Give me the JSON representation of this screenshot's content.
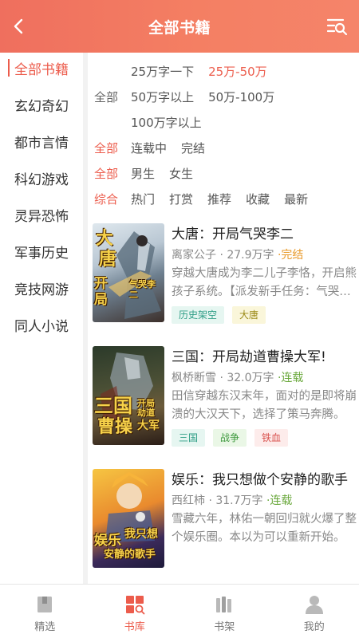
{
  "header": {
    "title": "全部书籍"
  },
  "sidebar": {
    "items": [
      {
        "label": "全部书籍",
        "active": true
      },
      {
        "label": "玄幻奇幻"
      },
      {
        "label": "都市言情"
      },
      {
        "label": "科幻游戏"
      },
      {
        "label": "灵异恐怖"
      },
      {
        "label": "军事历史"
      },
      {
        "label": "竞技网游"
      },
      {
        "label": "同人小说"
      }
    ]
  },
  "filters": {
    "words": {
      "lead": "全部",
      "options": [
        "25万字一下",
        "25万-50万",
        "50万字以上",
        "50万-100万",
        "100万字以上"
      ],
      "selected": "25万-50万"
    },
    "status": {
      "lead": "全部",
      "options": [
        "连载中",
        "完结"
      ]
    },
    "gender": {
      "lead": "全部",
      "options": [
        "男生",
        "女生"
      ]
    },
    "sort": {
      "lead": "综合",
      "options": [
        "热门",
        "打赏",
        "推荐",
        "收藏",
        "最新"
      ]
    }
  },
  "books": [
    {
      "title": "大唐：开局气哭李二",
      "author": "离家公子",
      "words": "27.9万字",
      "status": "·完结",
      "desc": "穿越大唐成为李二儿子李恪，开启熊孩子系统。【派发新手任务：气哭李二。】",
      "tags": [
        "历史架空",
        "大唐"
      ],
      "cover_text": [
        "大",
        "唐",
        "开局",
        "气哭李二"
      ]
    },
    {
      "title": "三国：开局劫道曹操大军!",
      "author": "枫桥断雪",
      "words": "32.0万字",
      "status": "·连载",
      "desc": "田信穿越东汉末年，面对的是即将崩溃的大汉天下，选择了策马奔腾。",
      "tags": [
        "三国",
        "战争",
        "铁血"
      ],
      "cover_text": [
        "三国",
        "曹操",
        "大军",
        "开局劫道"
      ]
    },
    {
      "title": "娱乐：我只想做个安静的歌手",
      "author": "西红柿",
      "words": "31.7万字",
      "status": "·连载",
      "desc": "雪藏六年，林佑一朝回归就火爆了整个娱乐圈。本以为可以重新开始。",
      "tags": [],
      "cover_text": [
        "娱乐",
        "我只想",
        "安静的歌手"
      ]
    }
  ],
  "tabbar": {
    "items": [
      {
        "label": "精选"
      },
      {
        "label": "书库",
        "active": true
      },
      {
        "label": "书架"
      },
      {
        "label": "我的"
      }
    ]
  },
  "colors": {
    "accent": "#ec5c4c",
    "header_start": "#ef6f5e",
    "header_end": "#f5846a"
  }
}
